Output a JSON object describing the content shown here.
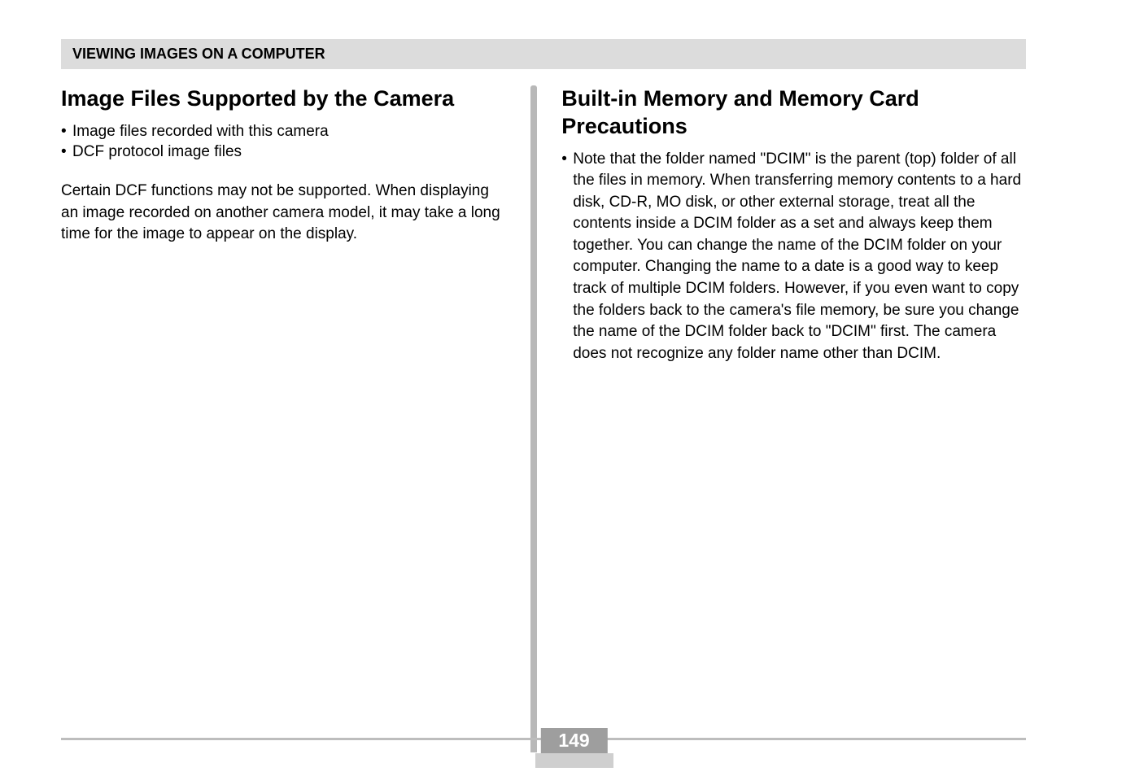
{
  "header": {
    "title": "VIEWING IMAGES ON A COMPUTER"
  },
  "left": {
    "heading": "Image Files Supported by the Camera",
    "bullets": [
      "Image files recorded with this camera",
      "DCF protocol image files"
    ],
    "paragraph": "Certain DCF functions may not be supported. When displaying an image recorded on another camera model, it may take a long time for the image to appear on the display."
  },
  "right": {
    "heading": "Built-in Memory and Memory Card Precautions",
    "bullet_marker": "•",
    "bullet_text": "Note that the folder named \"DCIM\" is the parent (top) folder of all the files in memory. When transferring memory contents to a hard disk, CD-R, MO disk, or other external storage, treat all the contents inside a DCIM folder as a set and always keep them together. You can change the name of the DCIM folder on your computer. Changing the name to a date is a good way to keep track of multiple DCIM folders. However, if you even want to copy the folders back to the camera's file memory, be sure you change the name of the DCIM folder back to \"DCIM\" first. The camera does not recognize any folder name other than DCIM."
  },
  "page_number": "149"
}
